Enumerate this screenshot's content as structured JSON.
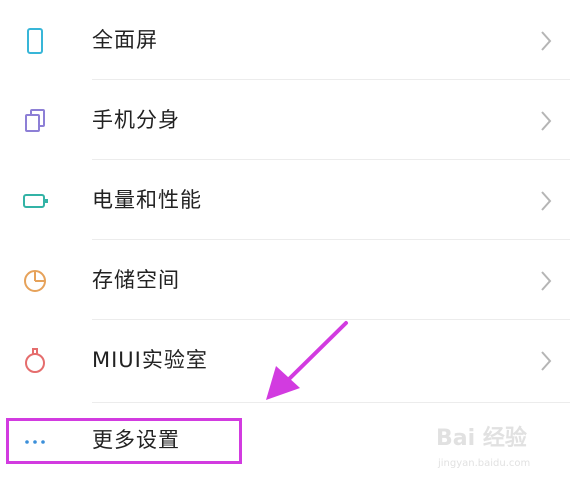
{
  "settings": {
    "items": [
      {
        "label": "全面屏",
        "icon": "phone-fullscreen-icon",
        "icon_color": "#38b6d8"
      },
      {
        "label": "手机分身",
        "icon": "dual-copy-icon",
        "icon_color": "#8d7fd6"
      },
      {
        "label": "电量和性能",
        "icon": "battery-icon",
        "icon_color": "#33b3a6"
      },
      {
        "label": "存储空间",
        "icon": "storage-pie-icon",
        "icon_color": "#e6a25a"
      },
      {
        "label": "MIUI实验室",
        "icon": "lab-flask-icon",
        "icon_color": "#e56d6d"
      },
      {
        "label": "更多设置",
        "icon": "more-dots-icon",
        "icon_color": "#3b8fd9"
      }
    ]
  },
  "annotation": {
    "highlight_color": "#d23be0",
    "highlighted_item": "更多设置"
  },
  "watermark": {
    "logo": "Bai 经验",
    "sub": "jingyan.baidu.com"
  }
}
